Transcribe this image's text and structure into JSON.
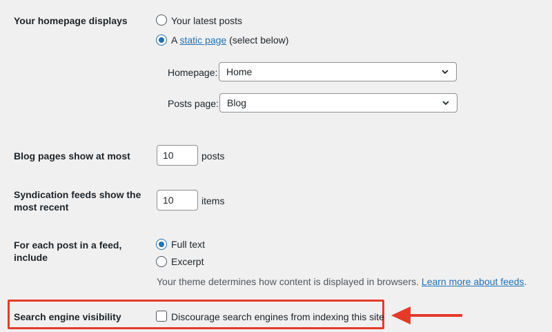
{
  "homepage_displays": {
    "label": "Your homepage displays",
    "options": [
      {
        "text": "Your latest posts",
        "checked": false
      },
      {
        "prefix": "A ",
        "link": "static page",
        "suffix": " (select below)",
        "checked": true
      }
    ],
    "homepage_select": {
      "label": "Homepage:",
      "value": "Home"
    },
    "posts_page_select": {
      "label": "Posts page:",
      "value": "Blog"
    }
  },
  "blog_pages": {
    "label": "Blog pages show at most",
    "value": "10",
    "unit": "posts"
  },
  "syndication": {
    "label_line1": "Syndication feeds show the",
    "label_line2": "most recent",
    "value": "10",
    "unit": "items"
  },
  "feed_include": {
    "label_line1": "For each post in a feed,",
    "label_line2": "include",
    "options": [
      {
        "text": "Full text",
        "checked": true
      },
      {
        "text": "Excerpt",
        "checked": false
      }
    ],
    "help_text": "Your theme determines how content is displayed in browsers. ",
    "help_link": "Learn more about feeds",
    "help_suffix": "."
  },
  "search_visibility": {
    "label": "Search engine visibility",
    "checkbox_text": "Discourage search engines from indexing this site",
    "checked": false
  },
  "annotation": {
    "highlight_color": "#e53a2a"
  }
}
